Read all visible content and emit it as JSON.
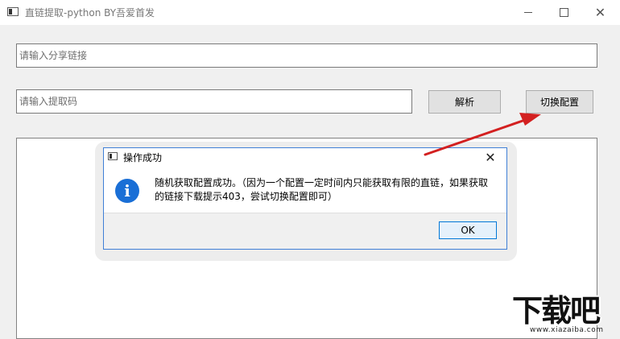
{
  "window": {
    "title": "直链提取-python BY吾爱首发",
    "minimize_icon": "minimize-icon",
    "maximize_icon": "maximize-icon",
    "close_icon": "close-icon",
    "close_glyph": "✕"
  },
  "form": {
    "share_link_placeholder": "请输入分享链接",
    "share_link_value": "",
    "extract_code_placeholder": "请输入提取码",
    "extract_code_value": "",
    "parse_label": "解析",
    "switch_config_label": "切换配置"
  },
  "dialog": {
    "title": "操作成功",
    "close_glyph": "✕",
    "info_glyph": "i",
    "message": "随机获取配置成功。（因为一个配置一定时间内只能获取有限的直链，如果获取的链接下载提示403，尝试切换配置即可）",
    "ok_label": "OK"
  },
  "annotation": {
    "arrow_color": "#d32020"
  },
  "watermark": {
    "text": "下载吧",
    "url": "www.xiazaiba.com"
  }
}
